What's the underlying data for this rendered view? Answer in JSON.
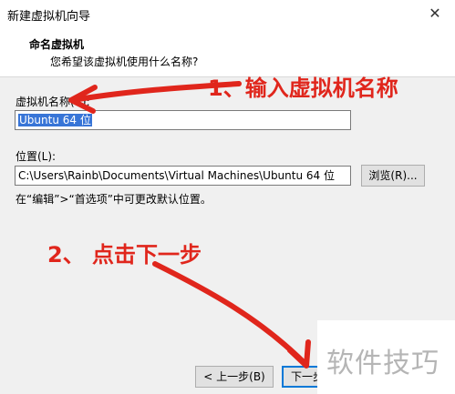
{
  "window": {
    "title": "新建虚拟机向导",
    "close_glyph": "✕"
  },
  "header": {
    "title": "命名虚拟机",
    "subtitle": "您希望该虚拟机使用什么名称?"
  },
  "name_field": {
    "label": "虚拟机名称(V):",
    "value": "Ubuntu 64 位"
  },
  "location_field": {
    "label": "位置(L):",
    "value": "C:\\Users\\Rainb\\Documents\\Virtual Machines\\Ubuntu 64 位",
    "browse_label": "浏览(R)..."
  },
  "hint": "在“编辑”>“首选项”中可更改默认位置。",
  "buttons": {
    "back": "< 上一步(B)",
    "next": "下一步"
  },
  "annotations": {
    "step1": "1、输入虚拟机名称",
    "step2": "2、 点击下一步",
    "color": "#e0261c"
  },
  "watermark": "软件技巧"
}
